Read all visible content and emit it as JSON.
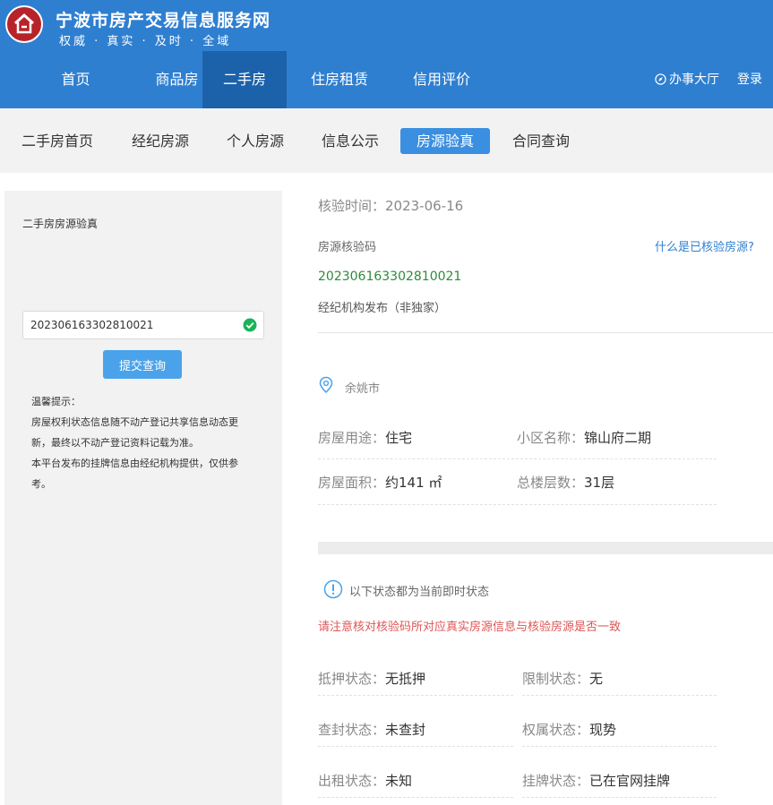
{
  "header": {
    "title": "宁波市房产交易信息服务网",
    "slogan": "权威 · 真实 · 及时 · 全域",
    "nav": [
      {
        "label": "首页"
      },
      {
        "label": "商品房"
      },
      {
        "label": "二手房"
      },
      {
        "label": "住房租赁"
      },
      {
        "label": "信用评价"
      }
    ],
    "hall_label": "办事大厅",
    "login_label": "登录",
    "brand_color": "#2f7fd0"
  },
  "subnav": [
    {
      "label": "二手房首页"
    },
    {
      "label": "经纪房源"
    },
    {
      "label": "个人房源"
    },
    {
      "label": "信息公示"
    },
    {
      "label": "房源验真"
    },
    {
      "label": "合同查询"
    }
  ],
  "left": {
    "title": "二手房房源验真",
    "input_value": "202306163302810021",
    "submit_label": "提交查询",
    "tips_title": "温馨提示：",
    "tips_1": "房屋权利状态信息随不动产登记共享信息动态更新，最终以不动产登记资料记载为准。",
    "tips_2": "本平台发布的挂牌信息由经纪机构提供，仅供参考。"
  },
  "result": {
    "time_label": "核验时间：2023-06-16",
    "code_label": "房源核验码",
    "what_link": "什么是已核验房源?",
    "code_value": "202306163302810021",
    "agency": "经纪机构发布（非独家）",
    "location": "余姚市",
    "usage_key": "房屋用途：",
    "usage_val": "住宅",
    "community_key": "小区名称：",
    "community_val": "锦山府二期",
    "area_key": "房屋面积：",
    "area_val": "约141 ㎡",
    "floors_key": "总楼层数：",
    "floors_val": "31层",
    "status_note": "以下状态都为当前即时状态",
    "warning": "请注意核对核验码所对应真实房源信息与核验房源是否一致",
    "mortgage_key": "抵押状态：",
    "mortgage_val": "无抵押",
    "restrict_key": "限制状态：",
    "restrict_val": "无",
    "seize_key": "查封状态：",
    "seize_val": "未查封",
    "ownership_key": "权属状态：",
    "ownership_val": "现势",
    "rent_key": "出租状态：",
    "rent_val": "未知",
    "listing_key": "挂牌状态：",
    "listing_val": "已在官网挂牌"
  }
}
